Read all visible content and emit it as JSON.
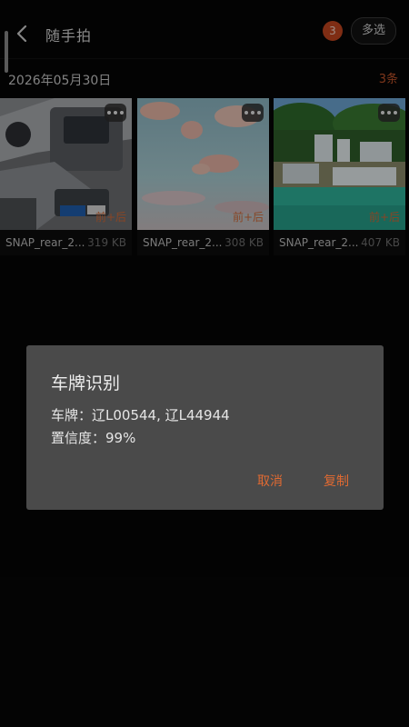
{
  "header": {
    "title": "随手拍",
    "badge_count": "3",
    "multi_select_label": "多选"
  },
  "section": {
    "date": "2026年05月30日",
    "count_label": "3条"
  },
  "photos": [
    {
      "name": "SNAP_rear_2...",
      "size": "319 KB",
      "tag": "前+后"
    },
    {
      "name": "SNAP_rear_2...",
      "size": "308 KB",
      "tag": "前+后"
    },
    {
      "name": "SNAP_rear_2...",
      "size": "407 KB",
      "tag": "前+后"
    }
  ],
  "dialog": {
    "title": "车牌识别",
    "plate_line": "车牌：辽L00544, 辽L44944",
    "confidence_line": "置信度：99%",
    "cancel_label": "取消",
    "copy_label": "复制"
  },
  "colors": {
    "accent": "#c4461f",
    "dialog_bg": "#4a4a4a",
    "background": "#060606"
  }
}
